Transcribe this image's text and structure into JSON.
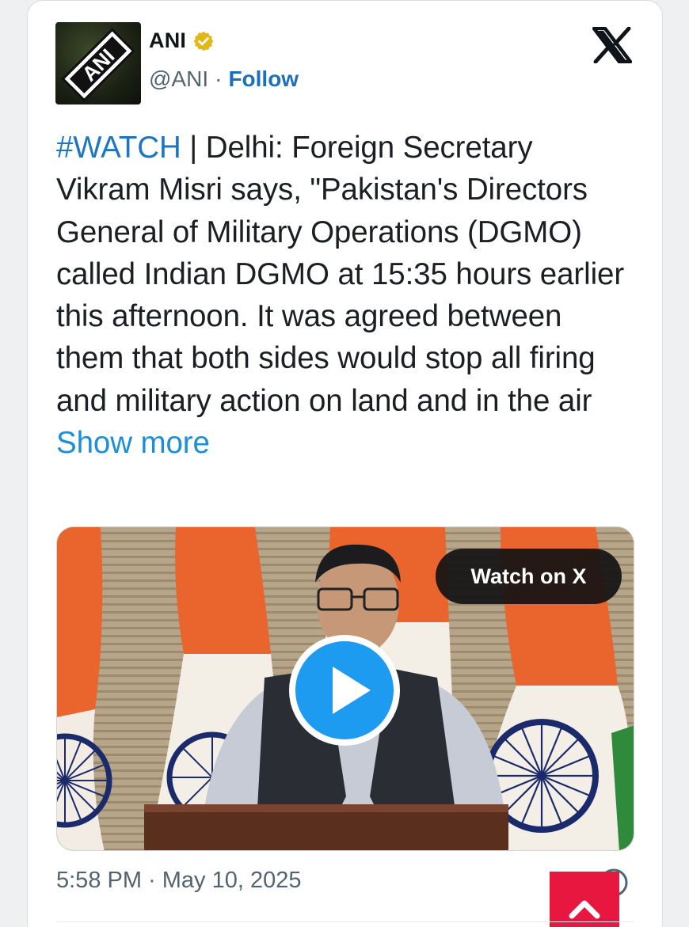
{
  "author": {
    "name": "ANI",
    "handle": "@ANI",
    "separator": "·",
    "follow_label": "Follow",
    "avatar_logo_text": "ANI",
    "verified": true
  },
  "icons": {
    "platform": "x-logo-icon",
    "verified": "verified-badge-icon",
    "play": "play-icon",
    "info": "info-icon",
    "scroll_top": "chevron-up-icon"
  },
  "tweet": {
    "hashtag": "#WATCH",
    "body": " | Delhi: Foreign Secretary Vikram Misri says, \"Pakistan's Directors General of Military Operations (DGMO) called Indian DGMO at 15:35 hours earlier this afternoon. It was agreed between them that both sides would stop all firing and military action on land and in the air ",
    "show_more": "Show more"
  },
  "media": {
    "watch_label": "Watch on X"
  },
  "footer": {
    "timestamp": "5:58 PM · May 10, 2025"
  },
  "colors": {
    "link": "#1d76c0",
    "verified_gold": "#e2b719",
    "play_blue": "#1d9bf0",
    "scroll_top_red": "#e8173f",
    "saffron": "#e9652d",
    "india_green": "#2f8a3b",
    "chakra_navy": "#1b2a6b"
  }
}
